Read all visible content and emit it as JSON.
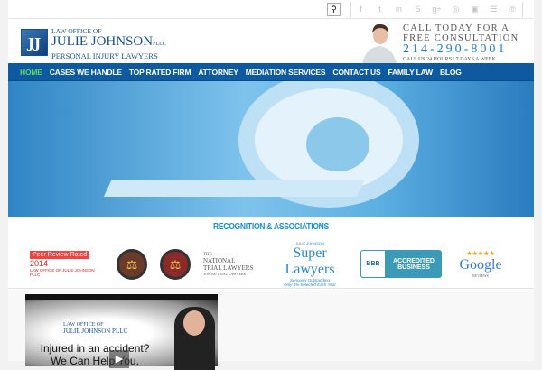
{
  "topbar": {
    "search_icon": "search-icon",
    "social": [
      "f",
      "t",
      "in",
      "S",
      "g+",
      "◎",
      "▣",
      "☰",
      "℗"
    ],
    "social_names": [
      "facebook",
      "twitter",
      "linkedin",
      "skype",
      "google-plus",
      "instagram",
      "youtube",
      "rss",
      "pinterest"
    ]
  },
  "logo": {
    "mark": "JJ",
    "line1": "LAW OFFICE OF",
    "line2": "JULIE JOHNSON",
    "suffix": "PLLC",
    "line3": "PERSONAL INJURY LAWYERS"
  },
  "cta": {
    "line1": "CALL TODAY FOR A",
    "line2": "FREE CONSULTATION",
    "phone": "214-290-8001",
    "line3": "CALL US 24 HOURS / 7 DAYS A WEEK"
  },
  "nav": [
    {
      "label": "HOME"
    },
    {
      "label": "CASES WE HANDLE"
    },
    {
      "label": "TOP RATED FIRM"
    },
    {
      "label": "ATTORNEY"
    },
    {
      "label": "MEDIATION SERVICES"
    },
    {
      "label": "CONTACT US"
    },
    {
      "label": "FAMILY LAW"
    },
    {
      "label": "BLOG"
    }
  ],
  "recognition": {
    "title": "RECOGNITION & ASSOCIATIONS",
    "peer": {
      "label": "Peer Review Rated",
      "year": "2014",
      "caption": "LAW OFFICE OF JULIE JOHNSON PLLC"
    },
    "ntl": {
      "l1": "THE",
      "l2": "NATIONAL",
      "l3": "TRIAL LAWYERS",
      "l4": "TOP 100 TRIAL LAWYERS"
    },
    "superlawyers": {
      "top": "JULIE JOHNSON",
      "name": "Super Lawyers",
      "sub1": "Seriously Outstanding",
      "sub2": "Only 5% Selected Each Year"
    },
    "bbb": {
      "logo": "BBB",
      "text1": "ACCREDITED",
      "text2": "BUSINESS"
    },
    "google": {
      "stars": "★★★★★",
      "name": "Google",
      "sub": "REVIEWS"
    }
  },
  "video": {
    "logo1": "LAW OFFICE OF",
    "logo2": "JULIE JOHNSON PLLC",
    "line1": "Injured in an accident?",
    "line2": "We Can Help You.",
    "play": "▶"
  }
}
